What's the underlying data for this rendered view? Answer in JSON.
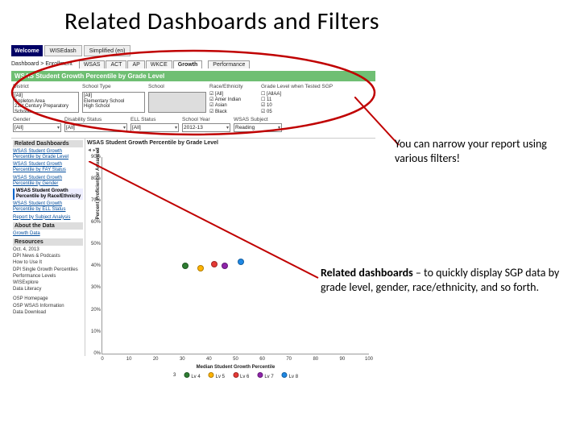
{
  "slide_title": "Related Dashboards and Filters",
  "navbar": {
    "welcome": "Welcome",
    "link1": "WISEdash",
    "link2": "Simplified (en)"
  },
  "tabbar": {
    "crumb_root": "Dashboard",
    "crumb_sep": ">",
    "crumb_leaf": "Enrollment",
    "tabs": [
      "WSAS",
      "ACT",
      "AP",
      "WKCE",
      "Growth"
    ],
    "extra": "Performance"
  },
  "page_title": "WSAS Student Growth Percentile by Grade Level",
  "filters": {
    "row1": [
      {
        "label": "District",
        "width": 82,
        "value": ""
      },
      {
        "label": "School Type",
        "width": 78,
        "value": ""
      },
      {
        "label": "School",
        "width": 72,
        "value": ""
      },
      {
        "label": "Race/Ethnicity",
        "width": 60,
        "value": ""
      },
      {
        "label": "Grade Level when Tested SGP",
        "width": 82,
        "value": ""
      }
    ],
    "row2": [
      {
        "type": "multi",
        "width": 82,
        "text": "[All]\nAppleton Area\n21st Century Preparatory School"
      },
      {
        "type": "multi",
        "width": 78,
        "text": "[All]\nElementary School\nHigh School"
      },
      {
        "type": "multi-blank",
        "width": 72
      },
      {
        "type": "checks",
        "width": 60,
        "items": [
          "☑ [All]",
          "☑ Amer Indian",
          "☑ Asian",
          "☑ Black"
        ]
      },
      {
        "type": "checks",
        "width": 82,
        "items": [
          "☐ [AllAA]",
          "☐ 11",
          "☑ 10",
          "☑ 05"
        ]
      }
    ],
    "row3": [
      {
        "label": "Gender",
        "width": 60,
        "sel": "[All]"
      },
      {
        "label": "Disability Status",
        "width": 78,
        "sel": "[All]"
      },
      {
        "label": "ELL Status",
        "width": 60,
        "sel": "[All]"
      },
      {
        "label": "School Year",
        "width": 60,
        "sel": "2012-13"
      },
      {
        "label": "WSAS Subject",
        "width": 60,
        "sel": "Reading"
      }
    ]
  },
  "sidebar": {
    "head1": "Related Dashboards",
    "links": [
      "WSAS Student Growth Percentile by Grade Level",
      "WSAS Student Growth Percentile by FAY Status",
      "WSAS Student Growth Percentile by Gender",
      "WSAS Student Growth Percentile by Race/Ethnicity",
      "WSAS Student Growth Percentile by ELL Status",
      "Report by Subject Analysis"
    ],
    "active_index": 3,
    "head2": "About the Data",
    "about": [
      "Growth Data"
    ],
    "head3": "Resources",
    "res": [
      "Oct. 4, 2013",
      "DPI News & Podcasts",
      "How to Use It",
      "DPI Single Growth Percentiles",
      "Performance Levels",
      "WISExplore",
      "Data Literacy"
    ],
    "foot": [
      "OSP Homepage",
      "OSP WSAS Information",
      "Data Download"
    ]
  },
  "chart": {
    "title": "WSAS Student Growth Percentile by Grade Level",
    "dl_icons": "◄ ▸  ⤓",
    "ylabel": "Percent Proficient or Advanced",
    "xlabel": "Median Student Growth Percentile",
    "legend_pre": "3",
    "legend": [
      {
        "name": "Lv 4",
        "color": "#2e7d32"
      },
      {
        "name": "Lv 5",
        "color": "#ffb300"
      },
      {
        "name": "Lv 6",
        "color": "#e53935"
      },
      {
        "name": "Lv 7",
        "color": "#8e24aa"
      },
      {
        "name": "Lv 8",
        "color": "#1e88e5"
      }
    ]
  },
  "chart_data": {
    "type": "scatter",
    "xlabel": "Median Student Growth Percentile",
    "ylabel": "Percent Proficient or Advanced",
    "xlim": [
      0,
      100
    ],
    "ylim": [
      0,
      90
    ],
    "xticks": [
      0,
      10,
      20,
      30,
      40,
      50,
      60,
      70,
      80,
      90,
      100
    ],
    "yticks": [
      0,
      10,
      20,
      30,
      40,
      50,
      60,
      70,
      80,
      90
    ],
    "series": [
      {
        "name": "Lv 4",
        "color": "#2e7d32",
        "points": [
          [
            31,
            40
          ]
        ]
      },
      {
        "name": "Lv 5",
        "color": "#ffb300",
        "points": [
          [
            37,
            39
          ]
        ]
      },
      {
        "name": "Lv 6",
        "color": "#e53935",
        "points": [
          [
            42,
            41
          ]
        ]
      },
      {
        "name": "Lv 7",
        "color": "#8e24aa",
        "points": [
          [
            46,
            40
          ]
        ]
      },
      {
        "name": "Lv 8",
        "color": "#1e88e5",
        "points": [
          [
            52,
            42
          ]
        ]
      }
    ]
  },
  "callouts": {
    "c1": "You can narrow your report using various filters!",
    "c2_b": "Related dashboards",
    "c2_rest": " – to quickly display SGP data by grade level, gender, race/ethnicity, and so forth."
  }
}
